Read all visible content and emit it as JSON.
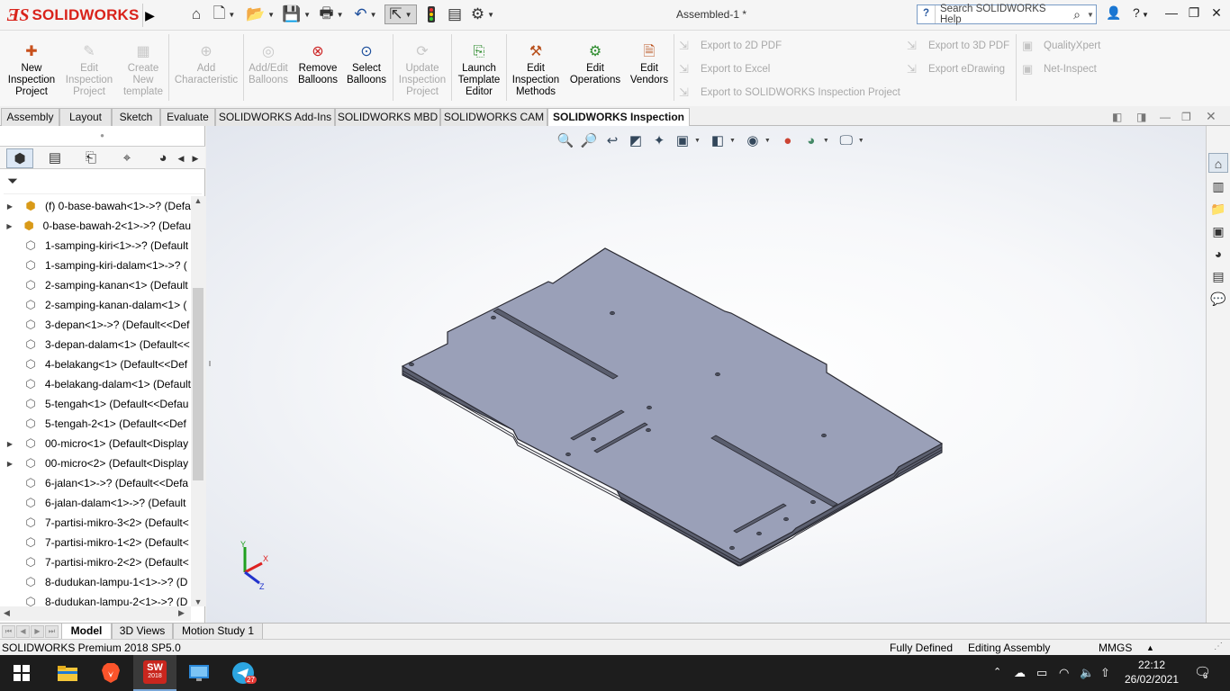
{
  "app": {
    "brand": "SOLIDWORKS",
    "document_title": "Assembled-1 *",
    "search_placeholder": "Search SOLIDWORKS Help"
  },
  "commands": {
    "new_inspection_project": "New\nInspection\nProject",
    "edit_inspection_project": "Edit\nInspection\nProject",
    "create_new_template": "Create\nNew\ntemplate",
    "add_characteristic": "Add\nCharacteristic",
    "add_edit_balloons": "Add/Edit\nBalloons",
    "remove_balloons": "Remove\nBalloons",
    "select_balloons": "Select\nBalloons",
    "update_inspection_project": "Update\nInspection\nProject",
    "launch_template_editor": "Launch\nTemplate\nEditor",
    "edit_inspection_methods": "Edit\nInspection\nMethods",
    "edit_operations": "Edit\nOperations",
    "edit_vendors": "Edit\nVendors",
    "export_2d_pdf": "Export to 2D PDF",
    "export_excel": "Export to Excel",
    "export_sw_inspection": "Export to SOLIDWORKS Inspection Project",
    "export_3d_pdf": "Export to 3D PDF",
    "export_edrawing": "Export eDrawing",
    "qualityxpert": "QualityXpert",
    "net_inspect": "Net-Inspect"
  },
  "command_tabs": [
    "Assembly",
    "Layout",
    "Sketch",
    "Evaluate",
    "SOLIDWORKS Add-Ins",
    "SOLIDWORKS MBD",
    "SOLIDWORKS CAM",
    "SOLIDWORKS Inspection"
  ],
  "active_command_tab": "SOLIDWORKS Inspection",
  "tree": [
    {
      "label": "(f) 0-base-bawah<1>->? (Defa",
      "expandable": true,
      "assembly": true
    },
    {
      "label": "0-base-bawah-2<1>->? (Defau",
      "expandable": true,
      "assembly": true
    },
    {
      "label": "1-samping-kiri<1>->? (Default",
      "expandable": false,
      "assembly": false
    },
    {
      "label": "1-samping-kiri-dalam<1>->? (",
      "expandable": false,
      "assembly": false
    },
    {
      "label": "2-samping-kanan<1> (Default",
      "expandable": false,
      "assembly": false
    },
    {
      "label": "2-samping-kanan-dalam<1> (",
      "expandable": false,
      "assembly": false
    },
    {
      "label": "3-depan<1>->? (Default<<Def",
      "expandable": false,
      "assembly": false
    },
    {
      "label": "3-depan-dalam<1> (Default<<",
      "expandable": false,
      "assembly": false
    },
    {
      "label": "4-belakang<1> (Default<<Def",
      "expandable": false,
      "assembly": false
    },
    {
      "label": "4-belakang-dalam<1> (Default",
      "expandable": false,
      "assembly": false
    },
    {
      "label": "5-tengah<1> (Default<<Defau",
      "expandable": false,
      "assembly": false
    },
    {
      "label": "5-tengah-2<1> (Default<<Def",
      "expandable": false,
      "assembly": false
    },
    {
      "label": "00-micro<1> (Default<Display",
      "expandable": true,
      "assembly": false
    },
    {
      "label": "00-micro<2> (Default<Display",
      "expandable": true,
      "assembly": false
    },
    {
      "label": "6-jalan<1>->? (Default<<Defa",
      "expandable": false,
      "assembly": false
    },
    {
      "label": "6-jalan-dalam<1>->? (Default",
      "expandable": false,
      "assembly": false
    },
    {
      "label": "7-partisi-mikro-3<2> (Default<",
      "expandable": false,
      "assembly": false
    },
    {
      "label": "7-partisi-mikro-1<2> (Default<",
      "expandable": false,
      "assembly": false
    },
    {
      "label": "7-partisi-mikro-2<2> (Default<",
      "expandable": false,
      "assembly": false
    },
    {
      "label": "8-dudukan-lampu-1<1>->? (D",
      "expandable": false,
      "assembly": false
    },
    {
      "label": "8-dudukan-lampu-2<1>->? (D",
      "expandable": false,
      "assembly": false
    }
  ],
  "bottom_tabs": [
    "Model",
    "3D Views",
    "Motion Study 1"
  ],
  "active_bottom_tab": "Model",
  "status": {
    "version": "SOLIDWORKS Premium 2018 SP5.0",
    "definition": "Fully Defined",
    "mode": "Editing Assembly",
    "units": "MMGS",
    "units_caret": "▲"
  },
  "triad": {
    "x": "X",
    "y": "Y",
    "z": "Z"
  },
  "taskbar": {
    "sw_badge": "2018",
    "telegram_badge": "27",
    "time": "22:12",
    "date": "26/02/2021",
    "notification_count": "6"
  },
  "colors": {
    "brand_red": "#d9231b",
    "part_face": "#9aa0b8",
    "part_edge": "#2b2b33",
    "taskbar": "#1d1d1d"
  }
}
